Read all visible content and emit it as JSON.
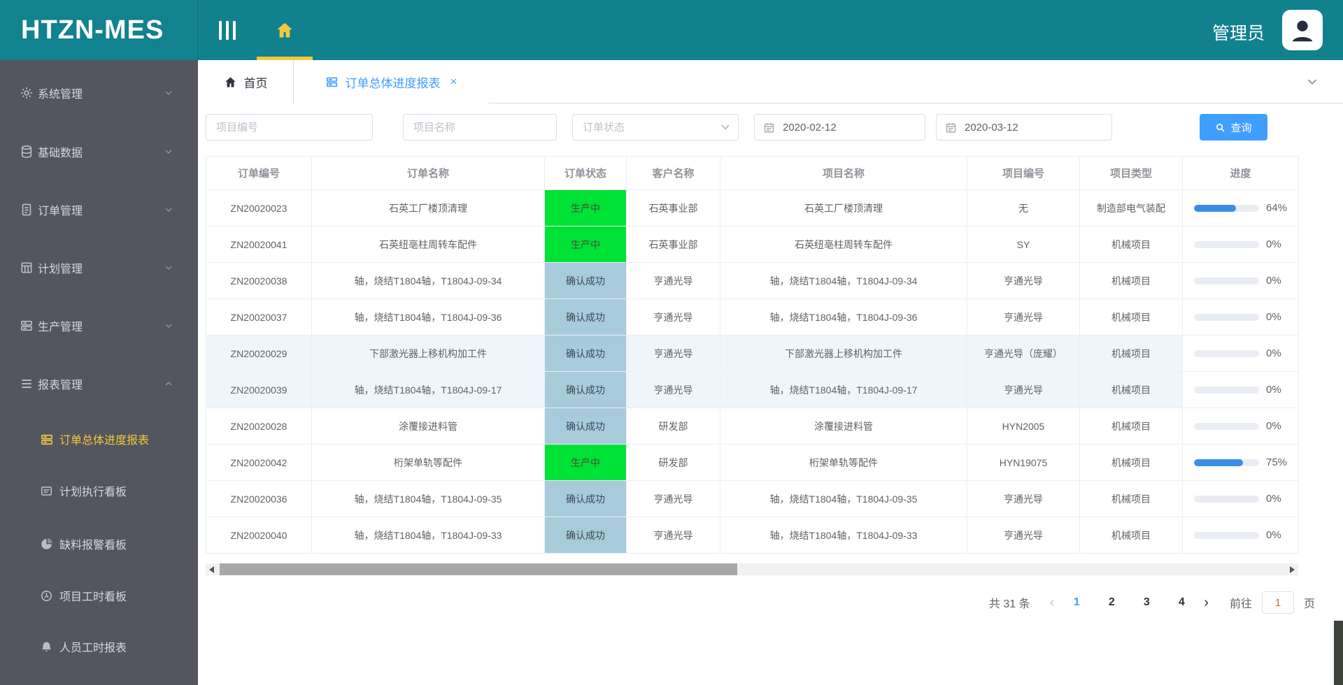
{
  "app": {
    "logo": "HTZN-MES",
    "user": "管理员"
  },
  "sidebar": {
    "items": [
      {
        "key": "system-management",
        "label": "系统管理",
        "icon": "gear-icon"
      },
      {
        "key": "base-data",
        "label": "基础数据",
        "icon": "database-icon"
      },
      {
        "key": "order-management",
        "label": "订单管理",
        "icon": "document-icon"
      },
      {
        "key": "plan-management",
        "label": "计划管理",
        "icon": "grid-icon"
      },
      {
        "key": "production-management",
        "label": "生产管理",
        "icon": "server-icon"
      },
      {
        "key": "report-management",
        "label": "报表管理",
        "icon": "list-icon",
        "expanded": true
      }
    ],
    "subitems": [
      {
        "key": "order-overall-progress-report",
        "label": "订单总体进度报表",
        "icon": "server-icon",
        "active": true
      },
      {
        "key": "plan-execution-board",
        "label": "计划执行看板",
        "icon": "board-icon"
      },
      {
        "key": "material-shortage-alarm-board",
        "label": "缺料报警看板",
        "icon": "pie-icon"
      },
      {
        "key": "project-hours-board",
        "label": "项目工时看板",
        "icon": "gauge-icon"
      },
      {
        "key": "personnel-hours-report",
        "label": "人员工时报表",
        "icon": "bell-icon"
      }
    ]
  },
  "tabs": [
    {
      "label": "首页"
    },
    {
      "label": "订单总体进度报表",
      "active": true,
      "close_glyph": "×"
    }
  ],
  "filters": {
    "project_code_placeholder": "项目编号",
    "project_name_placeholder": "项目名称",
    "order_status_placeholder": "订单状态",
    "date_from": "2020-02-12",
    "date_to": "2020-03-12",
    "search_label": "查询"
  },
  "table": {
    "columns": [
      "订单编号",
      "订单名称",
      "订单状态",
      "客户名称",
      "项目名称",
      "项目编号",
      "项目类型",
      "进度"
    ],
    "rows": [
      {
        "order_no": "ZN20020023",
        "order_name": "石英工厂楼顶清理",
        "status": "生产中",
        "status_type": "green",
        "customer": "石英事业部",
        "project_name": "石英工厂楼顶清理",
        "project_code": "无",
        "project_type": "制造部电气装配",
        "progress": 64
      },
      {
        "order_no": "ZN20020041",
        "order_name": "石英纽亳柱周转车配件",
        "status": "生产中",
        "status_type": "green",
        "customer": "石英事业部",
        "project_name": "石英纽亳柱周转车配件",
        "project_code": "SY",
        "project_type": "机械项目",
        "progress": 0
      },
      {
        "order_no": "ZN20020038",
        "order_name": "轴，烧结T1804轴，T1804J-09-34",
        "status": "确认成功",
        "status_type": "blue",
        "customer": "亨通光导",
        "project_name": "轴，烧结T1804轴，T1804J-09-34",
        "project_code": "亨通光导",
        "project_type": "机械项目",
        "progress": 0
      },
      {
        "order_no": "ZN20020037",
        "order_name": "轴，烧结T1804轴，T1804J-09-36",
        "status": "确认成功",
        "status_type": "blue",
        "customer": "亨通光导",
        "project_name": "轴，烧结T1804轴，T1804J-09-36",
        "project_code": "亨通光导",
        "project_type": "机械项目",
        "progress": 0
      },
      {
        "order_no": "ZN20020029",
        "order_name": "下部激光器上移机构加工件",
        "status": "确认成功",
        "status_type": "blue",
        "customer": "亨通光导",
        "project_name": "下部激光器上移机构加工件",
        "project_code": "亨通光导（庞耀）",
        "project_type": "机械项目",
        "progress": 0,
        "tinted": true
      },
      {
        "order_no": "ZN20020039",
        "order_name": "轴，烧结T1804轴，T1804J-09-17",
        "status": "确认成功",
        "status_type": "blue",
        "customer": "亨通光导",
        "project_name": "轴，烧结T1804轴，T1804J-09-17",
        "project_code": "亨通光导",
        "project_type": "机械项目",
        "progress": 0,
        "tinted": true
      },
      {
        "order_no": "ZN20020028",
        "order_name": "涂覆接进料管",
        "status": "确认成功",
        "status_type": "blue",
        "customer": "研发部",
        "project_name": "涂覆接进料管",
        "project_code": "HYN2005",
        "project_type": "机械项目",
        "progress": 0
      },
      {
        "order_no": "ZN20020042",
        "order_name": "桁架单轨等配件",
        "status": "生产中",
        "status_type": "green",
        "customer": "研发部",
        "project_name": "桁架单轨等配件",
        "project_code": "HYN19075",
        "project_type": "机械项目",
        "progress": 75
      },
      {
        "order_no": "ZN20020036",
        "order_name": "轴，烧结T1804轴，T1804J-09-35",
        "status": "确认成功",
        "status_type": "blue",
        "customer": "亨通光导",
        "project_name": "轴，烧结T1804轴，T1804J-09-35",
        "project_code": "亨通光导",
        "project_type": "机械项目",
        "progress": 0
      },
      {
        "order_no": "ZN20020040",
        "order_name": "轴，烧结T1804轴，T1804J-09-33",
        "status": "确认成功",
        "status_type": "blue",
        "customer": "亨通光导",
        "project_name": "轴，烧结T1804轴，T1804J-09-33",
        "project_code": "亨通光导",
        "project_type": "机械项目",
        "progress": 0
      }
    ]
  },
  "pagination": {
    "total_label": "共 31 条",
    "prev_glyph": "‹",
    "next_glyph": "›",
    "pages": [
      "1",
      "2",
      "3",
      "4"
    ],
    "current": "1",
    "goto_label": "前往",
    "goto_value": "1",
    "page_label": "页"
  },
  "colors": {
    "header_teal": "#11818e",
    "sidebar_gray": "#53565e",
    "accent_yellow": "#f5c83c",
    "accent_blue": "#409eff",
    "status_green": "#00e235",
    "status_blue": "#a8cbdc",
    "progress_blue": "#3a8ee6"
  }
}
